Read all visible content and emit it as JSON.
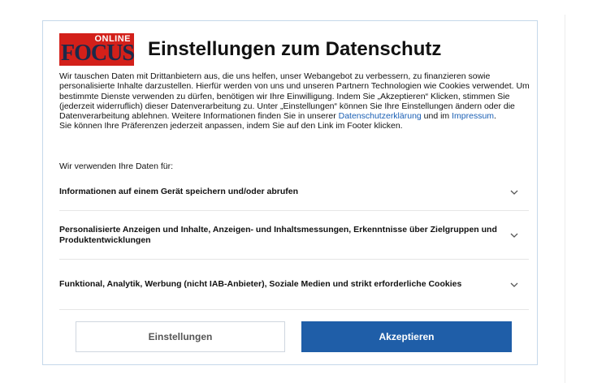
{
  "dialog": {
    "logo": {
      "online": "ONLINE",
      "brand": "FOCUS"
    },
    "title": "Einstellungen zum Datenschutz",
    "intro": {
      "text_1": "Wir tauschen Daten mit Drittanbietern aus, die uns helfen, unser Webangebot zu verbessern, zu finanzieren sowie personalisierte Inhalte darzustellen. Hierfür werden von uns und unseren Partnern Technologien wie Cookies verwendet. Um bestimmte Dienste verwenden zu dürfen, benötigen wir Ihre Einwilligung. Indem Sie „Akzeptieren“ Klicken, stimmen Sie (jederzeit widerruflich) dieser Datenverarbeitung zu. Unter „Einstellungen“ können Sie Ihre Einstellungen ändern oder die Datenverarbeitung ablehnen. Weitere Informationen finden Sie in unserer ",
      "privacy_link": "Datenschutzerklärung",
      "text_2": " und im ",
      "imprint_link": "Impressum",
      "text_3": ".",
      "text_4": "Sie können Ihre Präferenzen jederzeit anpassen, indem Sie auf den Link im Footer klicken."
    },
    "purposes_label": "Wir verwenden Ihre Daten für:",
    "purposes": [
      {
        "label": "Informationen auf einem Gerät speichern und/oder abrufen"
      },
      {
        "label": "Personalisierte Anzeigen und Inhalte, Anzeigen- und Inhaltsmessungen, Erkenntnisse über Zielgruppen und Produktentwicklungen"
      },
      {
        "label": "Funktional, Analytik, Werbung (nicht IAB-Anbieter), Soziale Medien und strikt erforderliche Cookies"
      }
    ],
    "buttons": {
      "settings": "Einstellungen",
      "accept": "Akzeptieren"
    },
    "colors": {
      "accent": "#1f5ea8",
      "logo_red": "#d3201a",
      "link": "#1a5fb4"
    }
  }
}
